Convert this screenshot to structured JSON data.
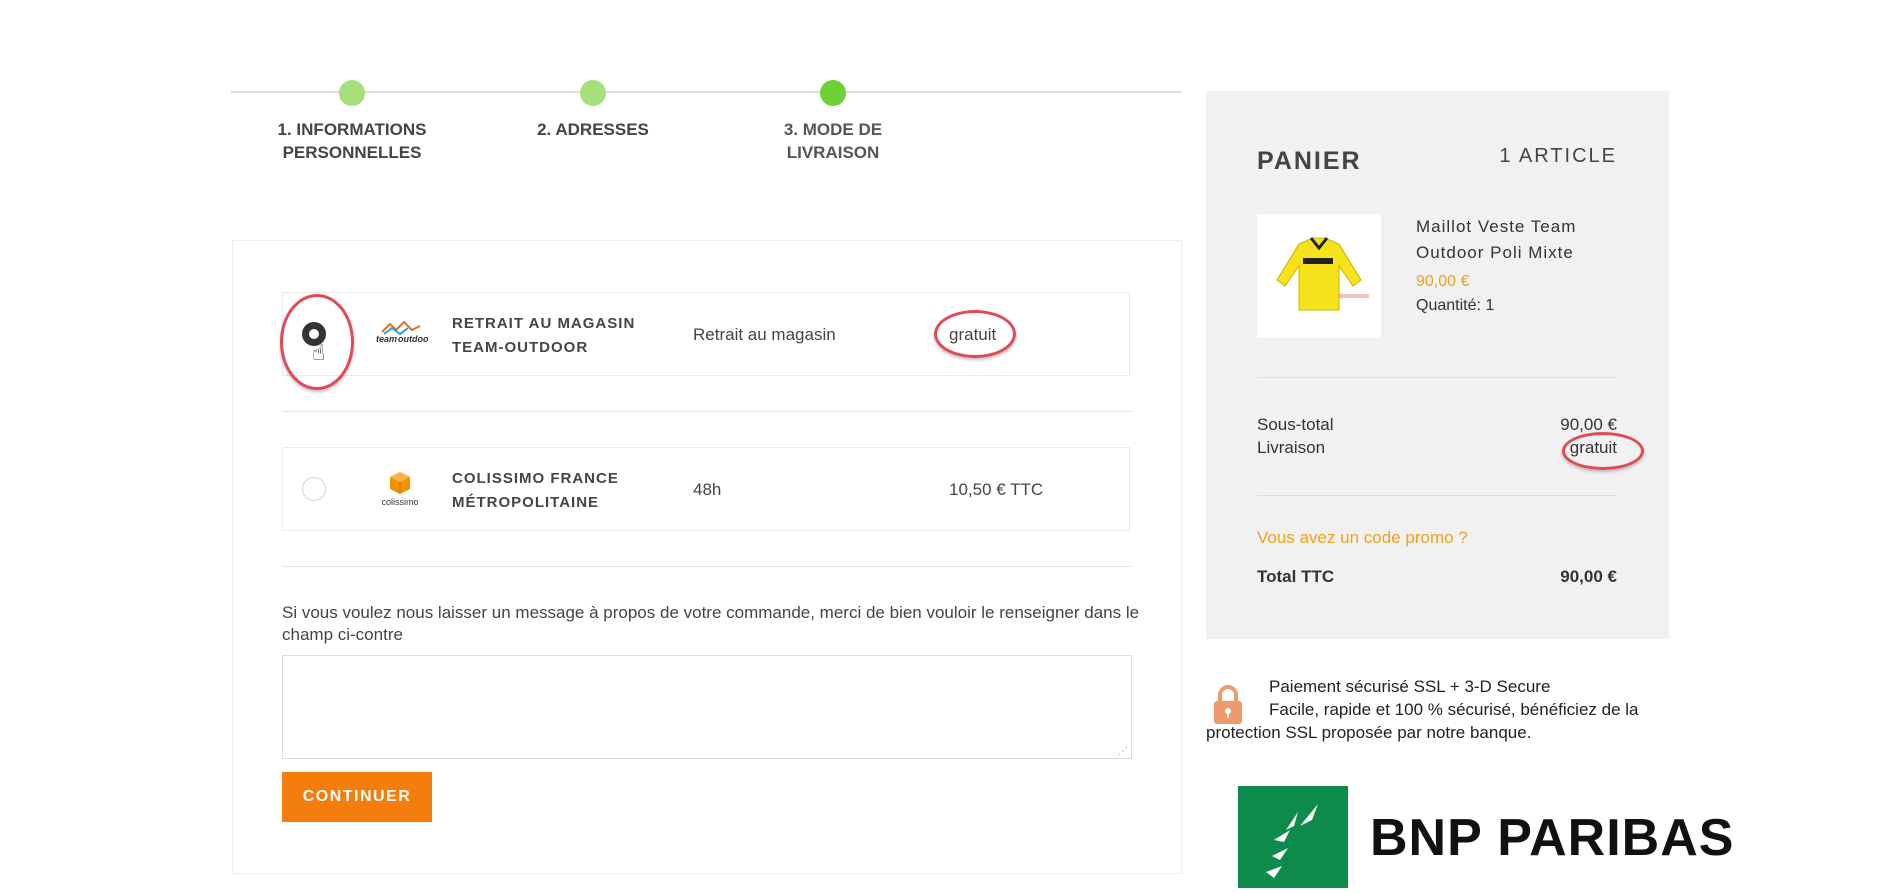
{
  "steps": [
    {
      "label_line1": "1. INFORMATIONS",
      "label_line2": "PERSONNELLES"
    },
    {
      "label_line1": "2. ADRESSES",
      "label_line2": ""
    },
    {
      "label_line1": "3. MODE DE",
      "label_line2": "LIVRAISON"
    }
  ],
  "carriers": [
    {
      "name_line1": "RETRAIT AU MAGASIN",
      "name_line2": "TEAM-OUTDOOR",
      "delay": "Retrait au magasin",
      "price": "gratuit",
      "logo": "team-outdoor-logo",
      "selected": true
    },
    {
      "name_line1": "COLISSIMO FRANCE",
      "name_line2": "MÉTROPOLITAINE",
      "delay": "48h",
      "price": "10,50 € TTC",
      "logo": "colissimo-logo",
      "selected": false
    }
  ],
  "message": {
    "label": "Si vous voulez nous laisser un message à propos de votre commande, merci de bien vouloir le renseigner dans le champ ci-contre",
    "value": ""
  },
  "continue_label": "CONTINUER",
  "cart": {
    "title": "PANIER",
    "count": "1 ARTICLE",
    "product": {
      "name": "Maillot Veste Team Outdoor Poli Mixte",
      "price": "90,00 €",
      "quantity": "Quantité: 1"
    },
    "subtotal_label": "Sous-total",
    "subtotal_value": "90,00 €",
    "shipping_label": "Livraison",
    "shipping_value": "gratuit",
    "promo": "Vous avez un code promo ?",
    "total_label": "Total TTC",
    "total_value": "90,00 €"
  },
  "secure": {
    "line1": "Paiement sécurisé SSL + 3-D Secure",
    "line2": "Facile, rapide et 100 % sécurisé, bénéficiez de la protection SSL proposée par notre banque."
  },
  "bank": {
    "name": "BNP PARIBAS"
  },
  "colors": {
    "accent": "#f57d0b",
    "price": "#f0a020",
    "step_done": "#a5e07a",
    "step_active": "#6fd135",
    "highlight_ring": "#e04a55"
  }
}
